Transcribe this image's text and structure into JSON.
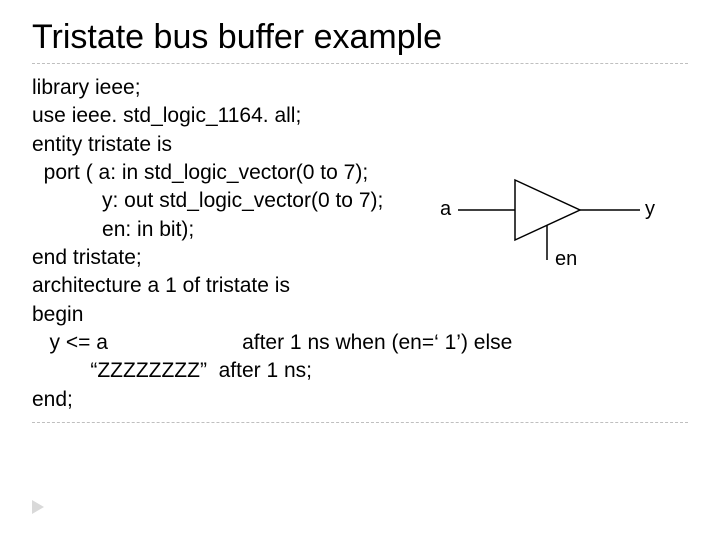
{
  "title": "Tristate bus buffer example",
  "code": {
    "l1": "library ieee;",
    "l2": "use ieee. std_logic_1164. all;",
    "l3": "entity tristate is",
    "l4": "  port ( a: in std_logic_vector(0 to 7);",
    "l5": "            y: out std_logic_vector(0 to 7);",
    "l6": "            en: in bit);",
    "l7": "end tristate;",
    "l8": "architecture a 1 of tristate is",
    "l9": "begin",
    "l10": "   y <= a                       after 1 ns when (en=‘ 1’) else",
    "l11": "          “ZZZZZZZZ”  after 1 ns;",
    "l12": "end;"
  },
  "diagram": {
    "a": "a",
    "y": "y",
    "en": "en"
  }
}
